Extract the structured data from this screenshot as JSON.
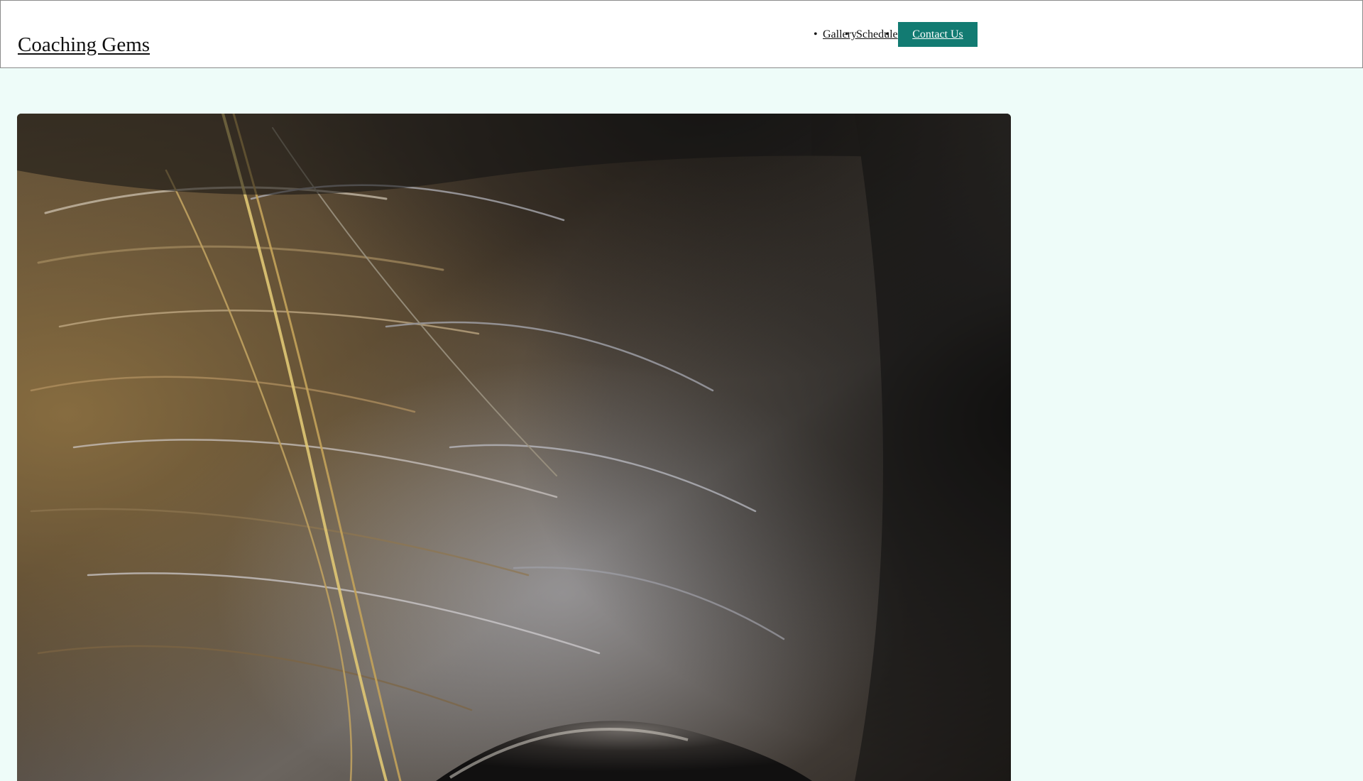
{
  "header": {
    "site_title": "Coaching Gems",
    "nav": {
      "items": [
        {
          "label": "Gallery"
        },
        {
          "label": "Schedule"
        }
      ],
      "cta_label": "Contact Us"
    }
  },
  "hero": {
    "image_subject": "close-up photo of dark horse fur around an eye"
  },
  "colors": {
    "page_background": "#eefcf9",
    "header_background": "#ffffff",
    "cta_background": "#127b72",
    "cta_text": "#ffffff"
  }
}
